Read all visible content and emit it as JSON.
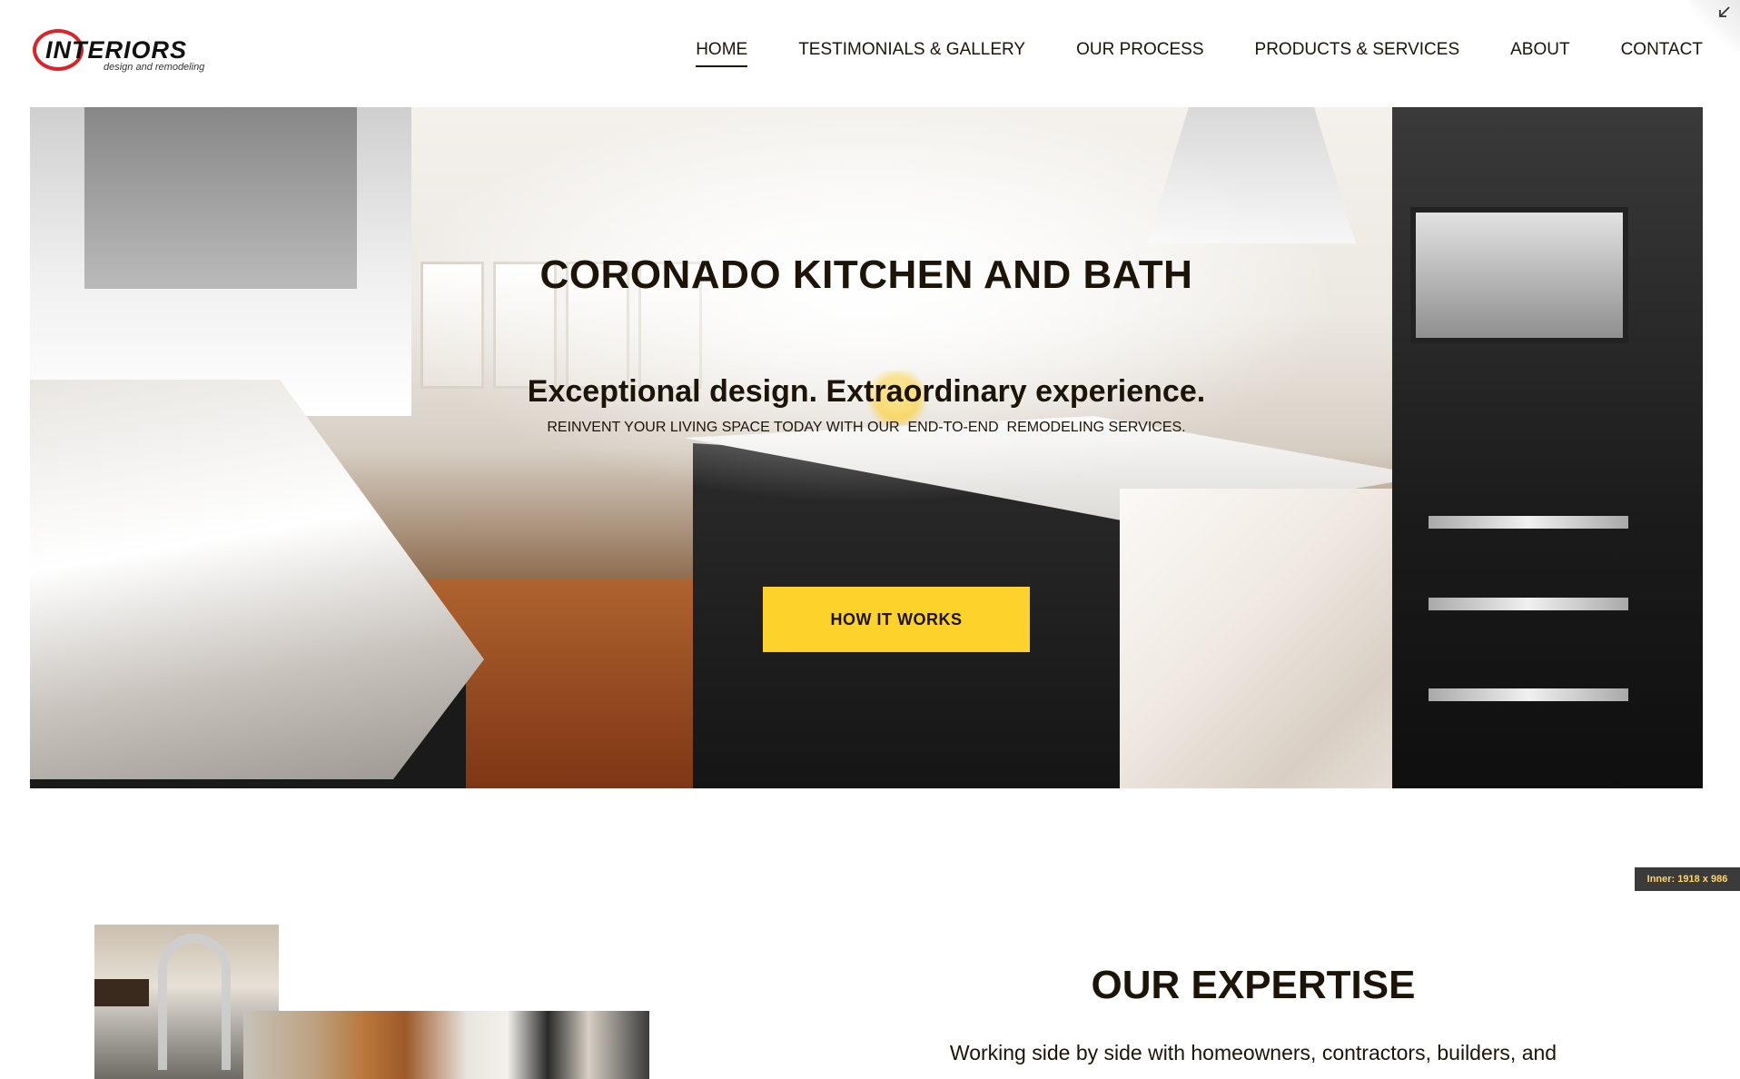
{
  "logo": {
    "wordmark": "INTERIORS",
    "tagline": "design and remodeling",
    "ring_color": "#d9242b"
  },
  "nav": {
    "items": [
      {
        "label": "HOME",
        "active": true
      },
      {
        "label": "TESTIMONIALS & GALLERY",
        "active": false
      },
      {
        "label": "OUR PROCESS",
        "active": false
      },
      {
        "label": "PRODUCTS & SERVICES",
        "active": false
      },
      {
        "label": "ABOUT",
        "active": false
      },
      {
        "label": "CONTACT",
        "active": false
      }
    ]
  },
  "corner": {
    "icon": "collapse-arrow-icon"
  },
  "hero": {
    "title": "CORONADO KITCHEN AND BATH",
    "subtitle": "Exceptional design. Extraordinary experience.",
    "tagline": "REINVENT YOUR LIVING SPACE TODAY WITH OUR  END-TO-END  REMODELING SERVICES.",
    "cta_label": "HOW IT WORKS",
    "cta_color": "#fdd22a"
  },
  "inner_badge": {
    "text": "Inner: 1918 x 986"
  },
  "expertise": {
    "title": "OUR EXPERTISE",
    "text": "Working side by side with homeowners, contractors, builders, and"
  },
  "colors": {
    "text": "#1d1408",
    "accent": "#fdd22a"
  }
}
